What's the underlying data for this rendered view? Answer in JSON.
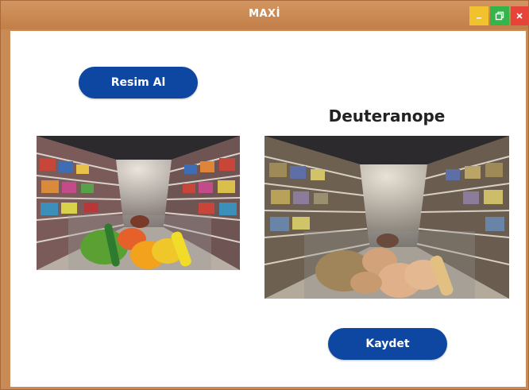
{
  "window": {
    "title": "MAXİ",
    "controls": {
      "minimize_icon": "minimize-icon",
      "maximize_icon": "maximize-icon",
      "close_icon": "close-icon"
    }
  },
  "buttons": {
    "capture_label": "Resim Al",
    "save_label": "Kaydet"
  },
  "filter": {
    "mode_label": "Deuteranope"
  },
  "colors": {
    "titlebar": "#c98a55",
    "button_bg": "#0d47a1",
    "minimize": "#f2c12e",
    "maximize": "#35b44a",
    "close": "#e8433a"
  }
}
